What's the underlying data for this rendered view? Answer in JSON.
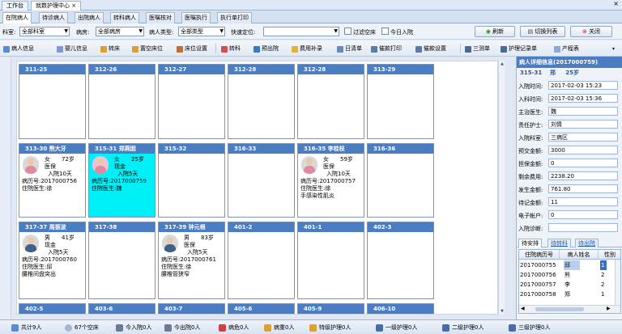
{
  "window": {
    "tabs": [
      "工作台",
      "就数护理中心"
    ],
    "close": "×",
    "min": "×"
  },
  "modules": [
    "在院病人",
    "待诊病人",
    "出院病人",
    "转科病人",
    "医嘱核对",
    "医嘱执行",
    "执行单打印"
  ],
  "filters": {
    "dept_label": "科室:",
    "dept_value": "全部科室",
    "ward_label": "病房:",
    "ward_value": "全部病房",
    "type_label": "病人类型:",
    "type_value": "全部类型",
    "locate_label": "快速定位:",
    "locate_value": "",
    "empty_label": "过滤空床",
    "today_label": "今日入院",
    "refresh": "刷新",
    "switch": "切换列表",
    "close": "关闭"
  },
  "toolbar": [
    "病人信息",
    "婴儿信息",
    "转床",
    "置空床位",
    "床位设置",
    "转科",
    "预出院",
    "费用补录",
    "日清单",
    "催款打印",
    "催款设置",
    "三测单",
    "护理记录单",
    "产程表"
  ],
  "grid": {
    "row1": [
      "311-25",
      "312-26",
      "312-27",
      "312-28",
      "312-28",
      "313-29"
    ],
    "row2": [
      {
        "head": "313-30  熊大牙",
        "gender": "女",
        "age": "72岁",
        "ins": "医保",
        "days": "入院10天",
        "rec": "病历号:2017000756",
        "doc": "住院医生:徐",
        "note": ""
      },
      {
        "head": "315-31  郑燕囡",
        "gender": "女",
        "age": "25岁",
        "ins": "现金",
        "days": "入院5天",
        "rec": "病历号:2017000759",
        "doc": "住院医生:魏",
        "note": ""
      },
      {
        "head": "315-32"
      },
      {
        "head": "316-33"
      },
      {
        "head": "316-35  李桂枝",
        "gender": "女",
        "age": "59岁",
        "ins": "医保",
        "days": "入院10天",
        "rec": "病历号:2017000757",
        "doc": "住院医生:徐",
        "note": "手感染性肌炎"
      },
      {
        "head": "316-36"
      }
    ],
    "row3": [
      {
        "head": "317-37  周振波",
        "gender": "男",
        "age": "41岁",
        "ins": "现金",
        "days": "入院5天",
        "rec": "病历号:2017000760",
        "doc": "住院医生:邱",
        "note": "腰椎间盘突出"
      },
      {
        "head": "317-38"
      },
      {
        "head": "317-39  钟元根",
        "gender": "男",
        "age": "83岁",
        "ins": "医保",
        "days": "入院5天",
        "rec": "病历号:2017000761",
        "doc": "住院医生:徐",
        "note": "腰椎管狭窄"
      },
      {
        "head": "401-2"
      },
      {
        "head": "401-1"
      },
      {
        "head": "402-3"
      }
    ],
    "row4": [
      "402-5",
      "403-6",
      "403-7",
      "405-6",
      "405-9",
      "406-10"
    ]
  },
  "detail": {
    "title": "病人详细信息(2017000759)",
    "bed": "315-31",
    "name": "郑",
    "age": "25岁",
    "rows": [
      {
        "label": "入院时间:",
        "value": "2017-02-03 15:23"
      },
      {
        "label": "入科时间:",
        "value": "2017-02-03 15:36"
      },
      {
        "label": "主治医生:",
        "value": "魏"
      },
      {
        "label": "责任护士:",
        "value": "刘情"
      },
      {
        "label": "入院科室:",
        "value": "三病区"
      },
      {
        "label": "预交金额:",
        "value": "3000"
      },
      {
        "label": "担保金额:",
        "value": "0"
      },
      {
        "label": "剩余费用:",
        "value": "2238.20"
      },
      {
        "label": "发生金额:",
        "value": "761.80"
      },
      {
        "label": "待记金额:",
        "value": "11"
      },
      {
        "label": "电子帐户:",
        "value": "0"
      },
      {
        "label": "入院诊断:",
        "value": ""
      }
    ],
    "tabs": [
      "待安排",
      "待转科",
      "待出院"
    ],
    "columns": [
      "住院病历号",
      "病人姓名",
      "性别"
    ],
    "records": [
      {
        "id": "2017000755",
        "name": "邱",
        "sex": "1"
      },
      {
        "id": "2017000756",
        "name": "熊",
        "sex": "2"
      },
      {
        "id": "2017000757",
        "name": "李",
        "sex": "2"
      },
      {
        "id": "2017000758",
        "name": "郑",
        "sex": "1"
      }
    ]
  },
  "status": [
    "共计9人",
    "67个空床",
    "今入院0人",
    "今出院0人",
    "病危0人",
    "病重0人",
    "特级护理0人",
    "一级护理0人",
    "二级护理0人",
    "三级护理0人"
  ],
  "colors": {
    "header_blue": "#4b7dc3",
    "selected_cell": "#00f0f8"
  }
}
